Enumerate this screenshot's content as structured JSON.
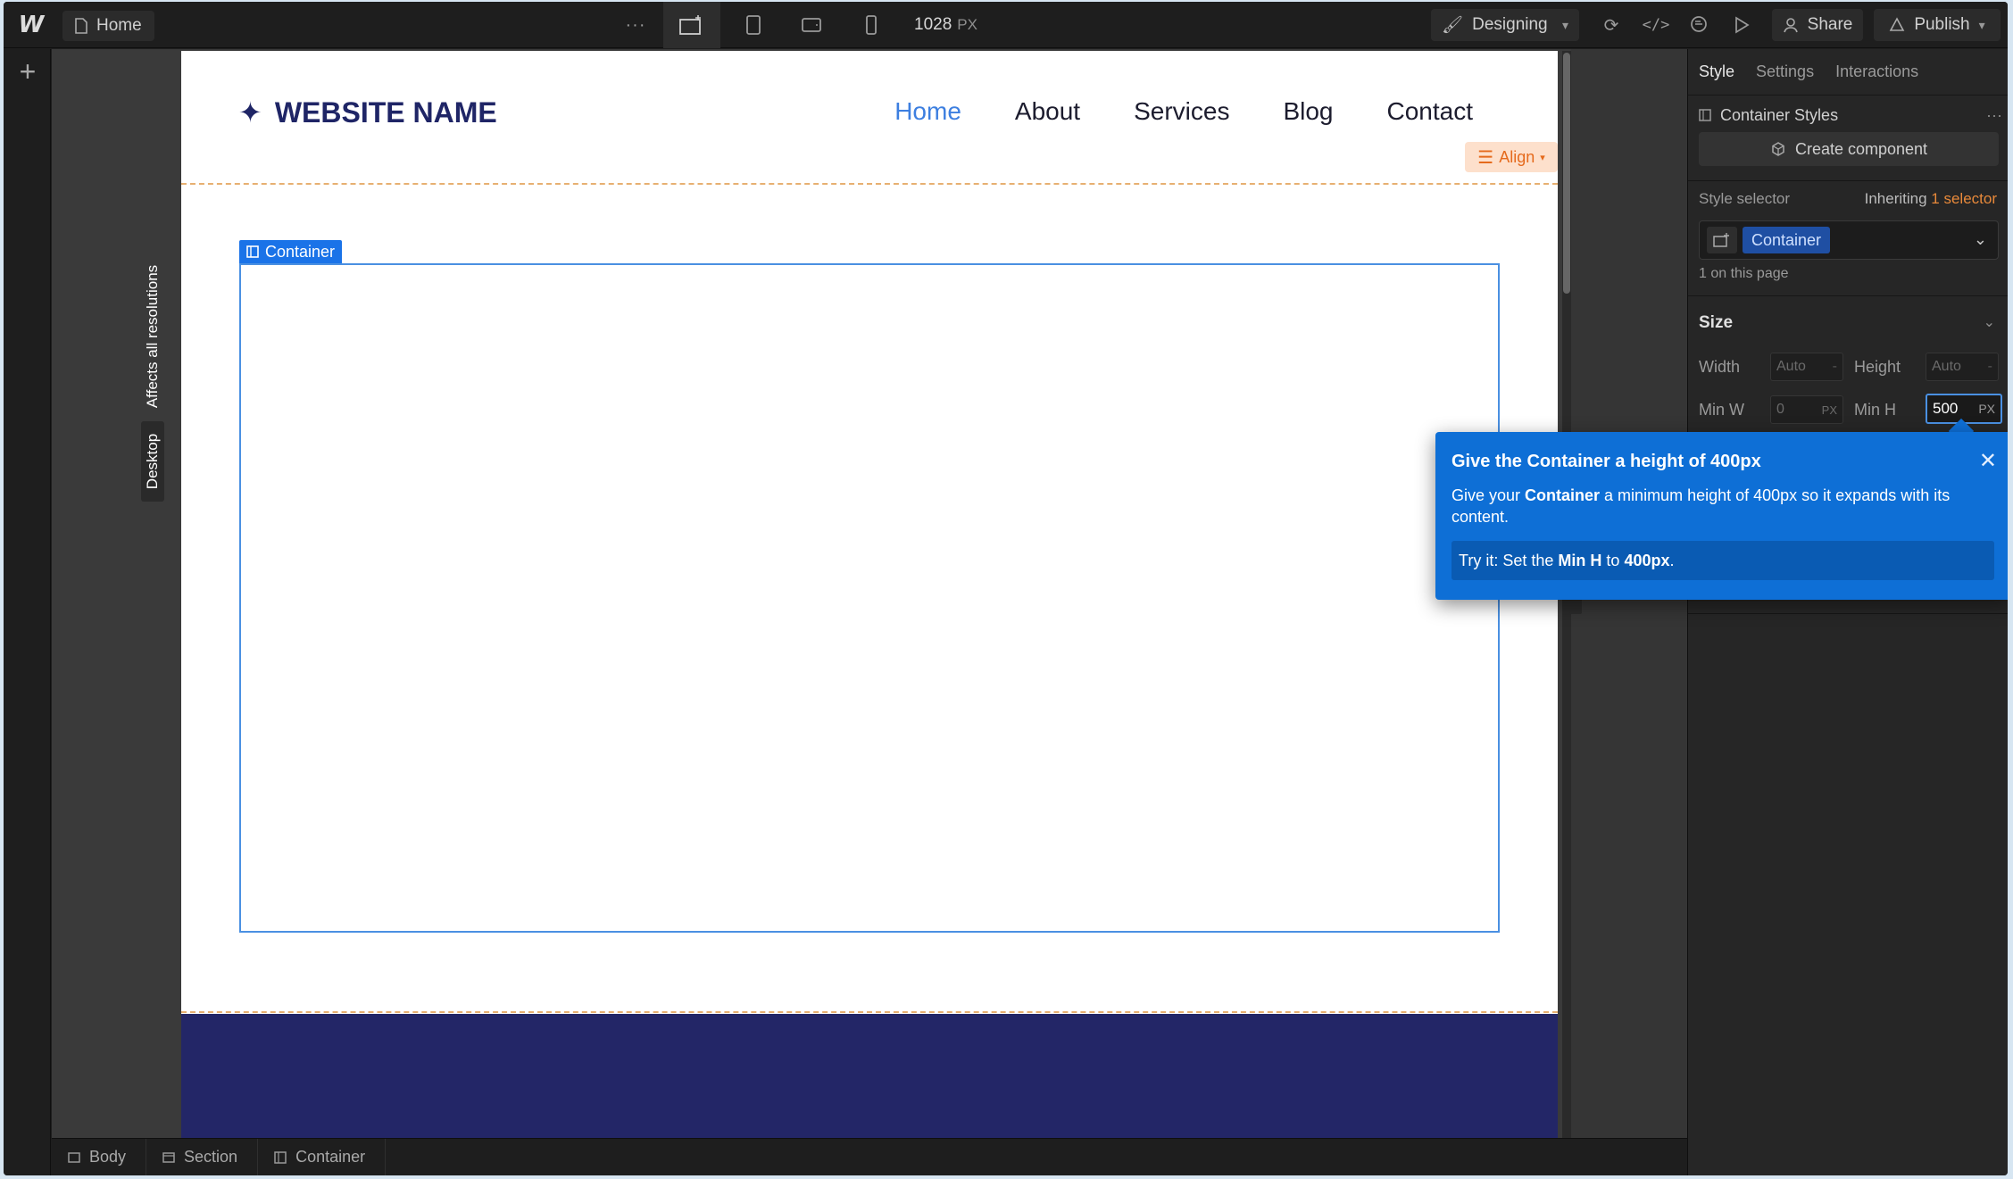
{
  "topbar": {
    "logo": "W",
    "page_name": "Home",
    "more": "···",
    "width_value": "1028",
    "width_unit": "PX",
    "mode": "Designing",
    "share": "Share",
    "publish": "Publish"
  },
  "canvas": {
    "resolution_tab_1": "Affects all resolutions",
    "resolution_tab_2": "Desktop",
    "brand_name": "WEBSITE NAME",
    "nav": [
      "Home",
      "About",
      "Services",
      "Blog",
      "Contact"
    ],
    "align_label": "Align",
    "container_tag": "Container",
    "footer_color": "#232667"
  },
  "breadcrumb": [
    "Body",
    "Section",
    "Container"
  ],
  "panel": {
    "tabs": [
      "Style",
      "Settings",
      "Interactions"
    ],
    "container_styles": "Container Styles",
    "create_component": "Create component",
    "style_selector": "Style selector",
    "inheriting_prefix": "Inheriting",
    "inheriting_link": "1 selector",
    "selector_chip": "Container",
    "on_page": "1 on this page",
    "size_heading": "Size",
    "width_label": "Width",
    "width_value": "Auto",
    "height_label": "Height",
    "height_value": "Auto",
    "minw_label": "Min W",
    "minw_value": "0",
    "minw_unit": "PX",
    "minh_label": "Min H",
    "minh_value": "500",
    "minh_unit": "PX"
  },
  "tour": {
    "title": "Give the Container a height of 400px",
    "body_pre": "Give your ",
    "body_bold": "Container",
    "body_post": " a minimum height of 400px so it expands with its content.",
    "try_pre": "Try it: Set the ",
    "try_bold1": "Min H",
    "try_mid": " to ",
    "try_bold2": "400px",
    "try_post": "."
  },
  "colors": {
    "accent_blue": "#1a73e8",
    "tour_blue": "#0e6fd6",
    "brand_navy": "#1f2566",
    "nav_active": "#3d7fe0",
    "align_orange": "#e56a1c"
  },
  "icons": [
    "webflow-logo-icon",
    "page-icon",
    "desktop-breakpoint-icon",
    "tablet-icon",
    "landscape-icon",
    "phone-icon",
    "brush-icon",
    "sync-icon",
    "code-icon",
    "comment-icon",
    "play-icon",
    "user-icon",
    "publish-icon",
    "add-icon",
    "close-icon"
  ]
}
